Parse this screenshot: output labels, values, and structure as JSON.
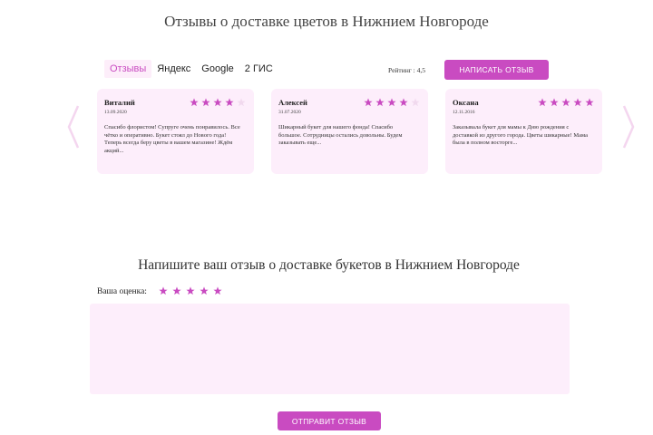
{
  "page": {
    "title": "Отзывы о доставке цветов в Нижнием Новгороде"
  },
  "tabs": [
    {
      "label": "Отзывы",
      "active": true
    },
    {
      "label": "Яндекс",
      "active": false
    },
    {
      "label": "Google",
      "active": false
    },
    {
      "label": "2 ГИС",
      "active": false
    }
  ],
  "rating_text": "Рейтинг : 4,5",
  "write_button_label": "НАПИСАТЬ ОТЗЫВ",
  "reviews": [
    {
      "name": "Виталий",
      "date": "13.09.2020",
      "stars": 4,
      "text": "Спасибо флористом! Супруге очень понравилось. Все чётко и оперативно. Букет стоял до Нового года! Теперь всегда беру цветы в вашем магазине! Ждём акций..."
    },
    {
      "name": "Алексей",
      "date": "31.07.2020",
      "stars": 4,
      "text": "Шикарный букет для нашего фонда! Спасибо большое. Сотрудницы остались довольны. Будем заказывать еще..."
    },
    {
      "name": "Оксана",
      "date": "12.11.2016",
      "stars": 5,
      "text": "Заказывала букет для мамы к Дню рождения с доставкой из другого города. Цветы шикарные! Мама была в полном восторге..."
    }
  ],
  "form": {
    "title": "Напишите ваш отзыв о доставке букетов в Нижнием Новгороде",
    "rating_label": "Ваша оценка:",
    "rating_value": 5,
    "review_text": "",
    "submit_label": "ОТПРАВИТ ОТЗЫВ"
  },
  "icons": {
    "star": "star-icon",
    "arrow_left": "chevron-left-icon",
    "arrow_right": "chevron-right-icon"
  },
  "colors": {
    "accent": "#c94bc1",
    "card_bg": "#fdeefb",
    "star_empty": "#f1d9ee",
    "arrow": "#f4d6ef"
  }
}
